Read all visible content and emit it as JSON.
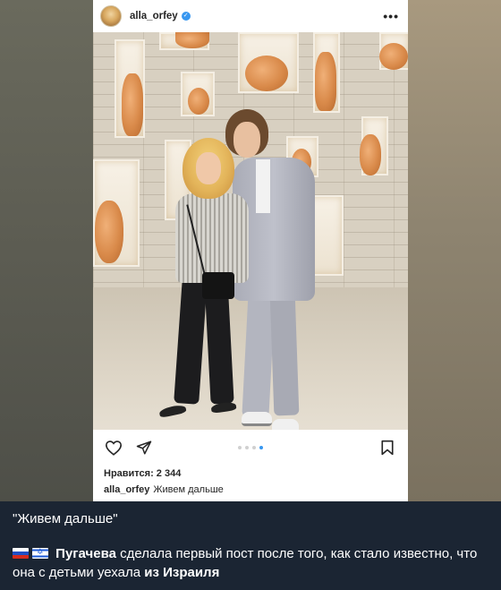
{
  "post": {
    "username": "alla_orfey",
    "verified": true,
    "more_icon": "ellipsis-icon",
    "likes_label": "Нравится: 2 344",
    "caption_user": "alla_orfey",
    "caption_text": "Живем дальше",
    "carousel": {
      "count": 4,
      "active_index": 3
    }
  },
  "actions": {
    "like_icon": "heart-icon",
    "share_icon": "send-icon",
    "save_icon": "bookmark-icon"
  },
  "message": {
    "quote": "\"Живем дальше\"",
    "flags": [
      "ru-flag",
      "il-flag"
    ],
    "name_bold": "Пугачева",
    "text_part1": " сделала первый пост после того, как стало известно, что она с детьми уехала ",
    "text_bold_end": "из Израиля"
  },
  "colors": {
    "accent": "#3897f0",
    "message_bg": "#1b2533"
  }
}
